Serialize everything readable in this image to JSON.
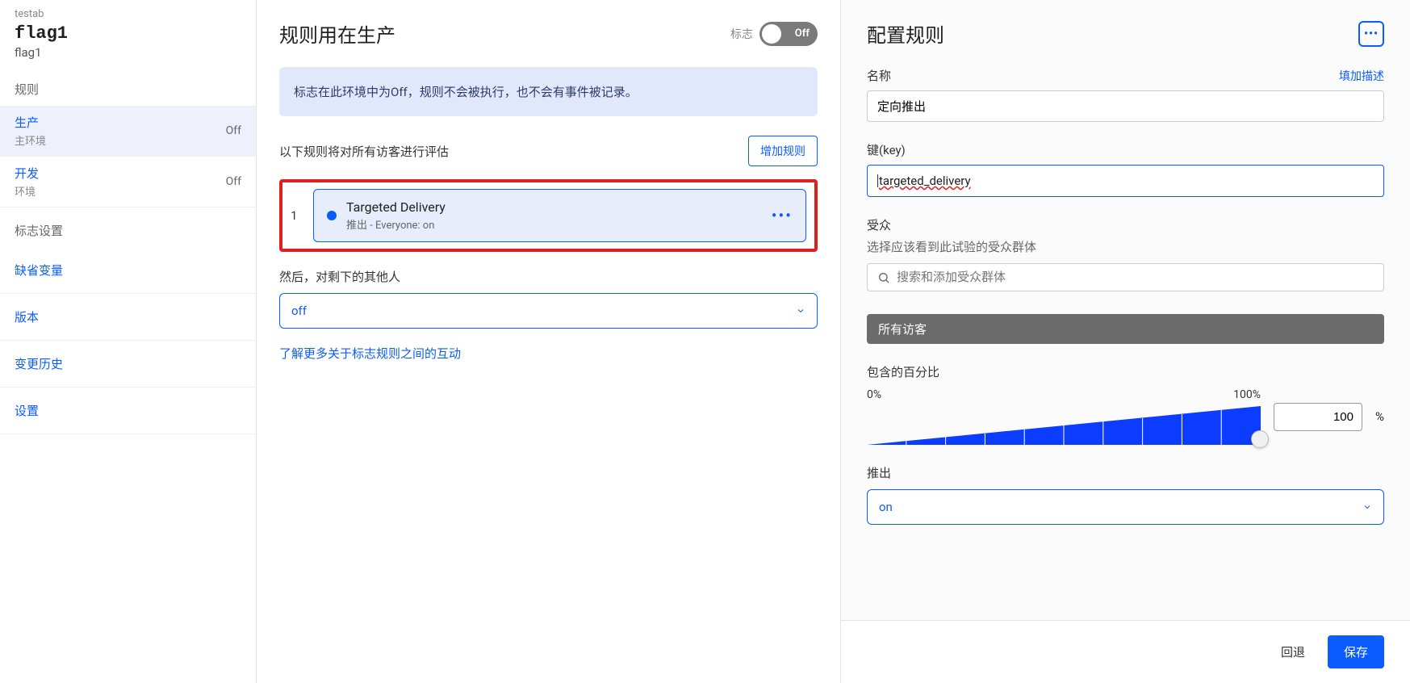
{
  "left": {
    "breadcrumb": "testab",
    "flag_name": "flag1",
    "flag_key": "flag1",
    "rules_label": "规则",
    "envs": [
      {
        "name": "生产",
        "sub": "主环境",
        "status": "Off",
        "active": true
      },
      {
        "name": "开发",
        "sub": "环境",
        "status": "Off",
        "active": false
      }
    ],
    "flag_settings_label": "标志设置",
    "nav": [
      {
        "label": "缺省变量"
      },
      {
        "label": "版本"
      },
      {
        "label": "变更历史"
      },
      {
        "label": "设置"
      }
    ]
  },
  "middle": {
    "title": "规则用在生产",
    "toggle_label": "标志",
    "toggle_state": "Off",
    "banner_text": "标志在此环境中为Off，规则不会被执行，也不会有事件被记录。",
    "rules_desc": "以下规则将对所有访客进行评估",
    "add_rule": "增加规则",
    "rule": {
      "index": "1",
      "title": "Targeted Delivery",
      "sub": "推出 - Everyone: on"
    },
    "else_label": "然后，对剩下的其他人",
    "else_value": "off",
    "learn_more": "了解更多关于标志规则之间的互动"
  },
  "right": {
    "title": "配置规则",
    "name_label": "名称",
    "add_desc_link": "填加描述",
    "name_value": "定向推出",
    "key_label": "键(key)",
    "key_value": "targeted_delivery",
    "audience_label": "受众",
    "audience_desc": "选择应该看到此试验的受众群体",
    "audience_search_placeholder": "搜索和添加受众群体",
    "all_visitors_tag": "所有访客",
    "percent_label": "包含的百分比",
    "slider_min": "0%",
    "slider_max": "100%",
    "percent_value": "100",
    "percent_sign": "%",
    "rollout_label": "推出",
    "rollout_value": "on",
    "back_btn": "回退",
    "save_btn": "保存"
  }
}
